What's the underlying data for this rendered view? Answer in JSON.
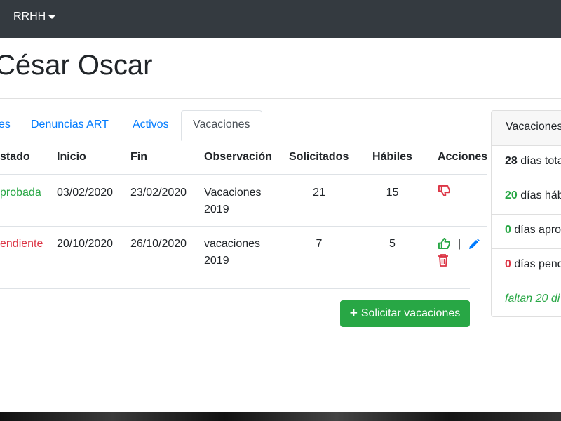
{
  "navbar": {
    "menu_label": "RRHH"
  },
  "header": {
    "title": "César Oscar"
  },
  "tabs": [
    {
      "label": "es"
    },
    {
      "label": "Denuncias ART"
    },
    {
      "label": "Activos"
    },
    {
      "label": "Vacaciones",
      "active": true
    }
  ],
  "table": {
    "headers": [
      "stado",
      "Inicio",
      "Fin",
      "Observación",
      "Solicitados",
      "Hábiles",
      "Acciones"
    ],
    "rows": [
      {
        "estado": "probada",
        "inicio": "03/02/2020",
        "fin": "23/02/2020",
        "obs1": "Vacaciones",
        "obs2": "2019",
        "solicitados": "21",
        "habiles": "15",
        "actions": [
          "thumbs-down-icon"
        ]
      },
      {
        "estado": "endiente",
        "inicio": "20/10/2020",
        "fin": "26/10/2020",
        "obs1": "vacaciones",
        "obs2": "2019",
        "solicitados": "7",
        "habiles": "5",
        "actions": [
          "thumbs-up-icon",
          "pencil-icon",
          "trash-icon"
        ],
        "separator": "|"
      }
    ]
  },
  "add_button": {
    "label": "Solicitar vacaciones",
    "icon": "plus-icon"
  },
  "summary_card": {
    "header": "Vacaciones",
    "items": [
      {
        "num": "28",
        "text": " días tota"
      },
      {
        "num": "20",
        "text": " días háb"
      },
      {
        "num": "0",
        "text": " días apro"
      },
      {
        "num": "0",
        "text": " días pend"
      }
    ],
    "footer": "faltan 20 di"
  },
  "colors": {
    "navbar": "#343a40",
    "link": "#007bff",
    "success": "#28a745",
    "danger": "#dc3545"
  }
}
